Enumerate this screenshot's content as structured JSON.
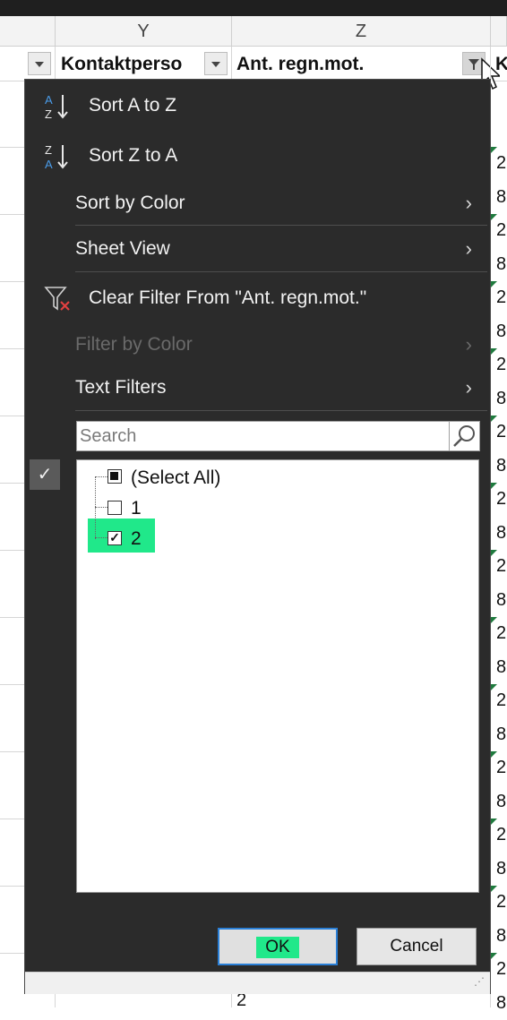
{
  "sheet": {
    "columns": [
      "Y",
      "Z"
    ],
    "header_cells": [
      "Kontaktperso",
      "Ant. regn.mot.",
      "K"
    ],
    "right_column_values": [
      "2",
      "8",
      "2",
      "8",
      "2",
      "8",
      "2",
      "8",
      "2",
      "8",
      "2",
      "8",
      "2",
      "8",
      "2",
      "8",
      "2",
      "8",
      "2",
      "8",
      "2",
      "8",
      "2",
      "8",
      "2",
      "8"
    ],
    "bottom_cell_value": "2"
  },
  "menu": {
    "sort_az": "Sort A to Z",
    "sort_za": "Sort Z to A",
    "sort_by_color": "Sort by Color",
    "sheet_view": "Sheet View",
    "clear_filter": "Clear Filter From \"Ant. regn.mot.\"",
    "filter_by_color": "Filter by Color",
    "text_filters": "Text Filters",
    "search_placeholder": "Search",
    "list_items": [
      {
        "label": "(Select All)",
        "state": "partial"
      },
      {
        "label": "1",
        "state": "unchecked"
      },
      {
        "label": "2",
        "state": "checked"
      }
    ],
    "ok_label": "OK",
    "cancel_label": "Cancel"
  },
  "colors": {
    "menu_bg": "#2b2b2b",
    "highlight": "#20e88a",
    "focus_border": "#2a7fd6"
  }
}
